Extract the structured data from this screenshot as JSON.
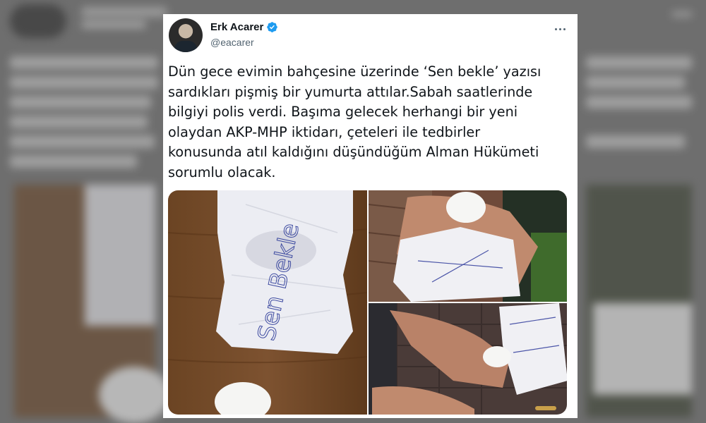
{
  "tweet": {
    "author_name": "Erk Acarer",
    "author_handle": "@eacarer",
    "verified": true,
    "more_icon": "ellipsis-horizontal-icon",
    "verified_icon": "verified-badge-icon",
    "accent_color": "#1d9bf0",
    "text": "Dün gece evimin bahçesine üzerinde ‘Sen bekle’ yazısı\nsardıkları pişmiş bir yumurta attılar.Sabah saatlerinde\nbilgiyi polis verdi. Başıma gelecek herhangi bir yeni\nolaydan AKP-MHP iktidarı, çeteleri ile tedbirler\nkonusunda atıl kaldığını düşündüğüm Alman Hükümeti\nsorumlu olacak.",
    "media": {
      "count": 3,
      "handwritten_note": "Sen Bekle"
    }
  }
}
